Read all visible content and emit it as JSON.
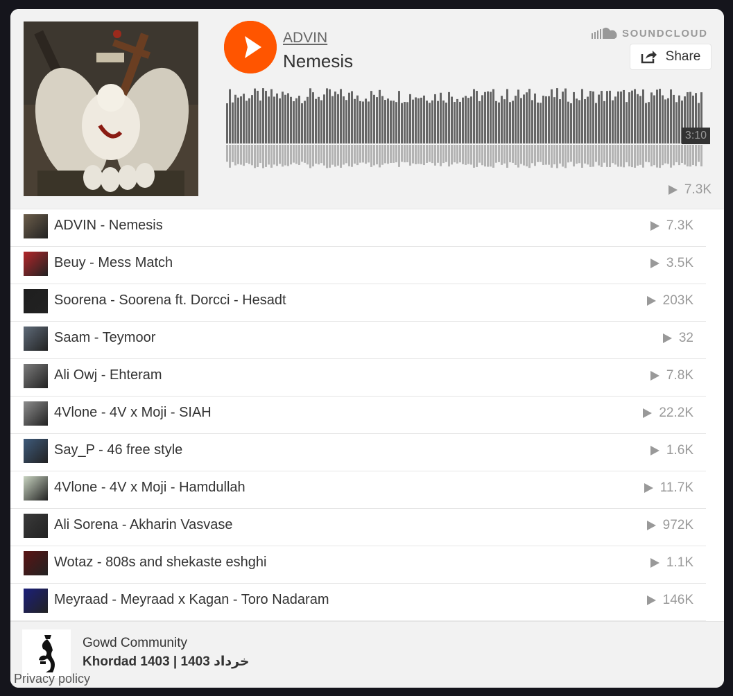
{
  "player": {
    "artist": "ADVIN",
    "title": "Nemesis",
    "brand": "SOUNDCLOUD",
    "share_label": "Share",
    "duration": "3:10",
    "plays": "7.3K",
    "accent_color": "#ff5500"
  },
  "tracks": [
    {
      "name": "ADVIN - Nemesis",
      "plays": "7.3K",
      "thumb_color": "#6b5d4a"
    },
    {
      "name": "Beuy - Mess Match",
      "plays": "3.5K",
      "thumb_color": "#b3262a"
    },
    {
      "name": "Soorena - Soorena ft. Dorcci - Hesadt",
      "plays": "203K",
      "thumb_color": "#1e1e1e"
    },
    {
      "name": "Saam - Teymoor",
      "plays": "32",
      "thumb_color": "#5e6a78"
    },
    {
      "name": "Ali Owj - Ehteram",
      "plays": "7.8K",
      "thumb_color": "#7b7b7b"
    },
    {
      "name": "4Vlone - 4V x Moji - SIAH",
      "plays": "22.2K",
      "thumb_color": "#8c8c8c"
    },
    {
      "name": "Say_P - 46 free style",
      "plays": "1.6K",
      "thumb_color": "#3e5a7a"
    },
    {
      "name": "4Vlone - 4V x Moji - Hamdullah",
      "plays": "11.7K",
      "thumb_color": "#c8d3c0"
    },
    {
      "name": "Ali Sorena - Akharin Vasvase",
      "plays": "972K",
      "thumb_color": "#3a3a3a"
    },
    {
      "name": "Wotaz - 808s and shekaste eshghi",
      "plays": "1.1K",
      "thumb_color": "#5a1414"
    },
    {
      "name": "Meyraad - Meyraad x Kagan - Toro Nadaram",
      "plays": "146K",
      "thumb_color": "#1b1f7a"
    }
  ],
  "footer": {
    "user": "Gowd Community",
    "date": "Khordad 1403 | 1403 خرداد",
    "privacy": "Privacy policy"
  }
}
